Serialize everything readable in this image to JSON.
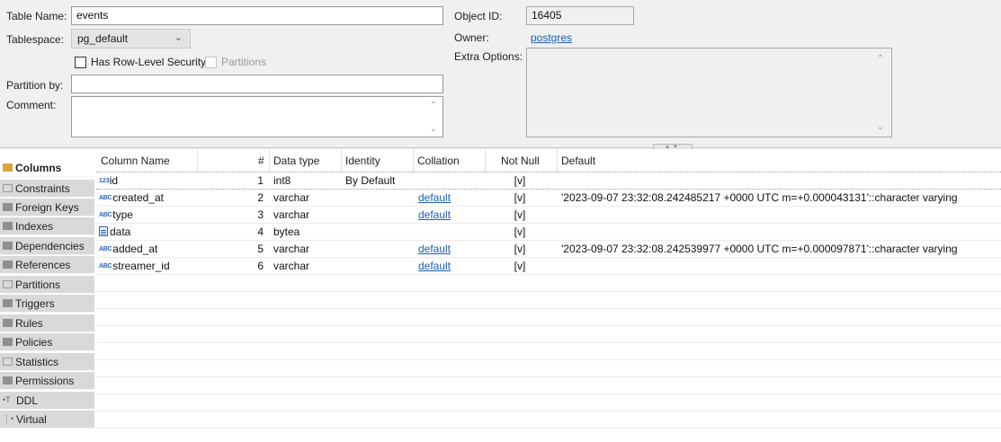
{
  "properties": {
    "table_name_label": "Table Name:",
    "table_name_value": "events",
    "tablespace_label": "Tablespace:",
    "tablespace_value": "pg_default",
    "rls_label": "Has Row-Level Security",
    "partitions_label": "Partitions",
    "partition_by_label": "Partition by:",
    "partition_by_value": "",
    "comment_label": "Comment:",
    "comment_value": "",
    "object_id_label": "Object ID:",
    "object_id_value": "16405",
    "owner_label": "Owner:",
    "owner_value": "postgres",
    "extra_options_label": "Extra Options:",
    "extra_options_value": ""
  },
  "tabs": [
    {
      "label": "Columns",
      "icon": "columns-icon",
      "active": true
    },
    {
      "label": "Constraints",
      "icon": "constraints-icon",
      "active": false
    },
    {
      "label": "Foreign Keys",
      "icon": "foreign-keys-icon",
      "active": false
    },
    {
      "label": "Indexes",
      "icon": "indexes-icon",
      "active": false
    },
    {
      "label": "Dependencies",
      "icon": "dependencies-icon",
      "active": false
    },
    {
      "label": "References",
      "icon": "references-icon",
      "active": false
    },
    {
      "label": "Partitions",
      "icon": "partitions-icon",
      "active": false
    },
    {
      "label": "Triggers",
      "icon": "triggers-icon",
      "active": false
    },
    {
      "label": "Rules",
      "icon": "rules-icon",
      "active": false
    },
    {
      "label": "Policies",
      "icon": "policies-icon",
      "active": false
    },
    {
      "label": "Statistics",
      "icon": "statistics-icon",
      "active": false
    },
    {
      "label": "Permissions",
      "icon": "permissions-icon",
      "active": false
    },
    {
      "label": "DDL",
      "icon": "ddl-icon",
      "active": false
    },
    {
      "label": "Virtual",
      "icon": "virtual-icon",
      "active": false
    }
  ],
  "grid": {
    "headers": [
      "Column Name",
      "#",
      "Data type",
      "Identity",
      "Collation",
      "Not Null",
      "Default"
    ],
    "rows": [
      {
        "name": "id",
        "icon": "123",
        "num": "1",
        "type": "int8",
        "identity": "By Default",
        "collation": "",
        "not_null": "[v]",
        "default": ""
      },
      {
        "name": "created_at",
        "icon": "ABC",
        "num": "2",
        "type": "varchar",
        "identity": "",
        "collation": "default",
        "not_null": "[v]",
        "default": "'2023-09-07 23:32:08.242485217 +0000 UTC m=+0.000043131'::character varying"
      },
      {
        "name": "type",
        "icon": "ABC",
        "num": "3",
        "type": "varchar",
        "identity": "",
        "collation": "default",
        "not_null": "[v]",
        "default": ""
      },
      {
        "name": "data",
        "icon": "binary",
        "num": "4",
        "type": "bytea",
        "identity": "",
        "collation": "",
        "not_null": "[v]",
        "default": ""
      },
      {
        "name": "added_at",
        "icon": "ABC",
        "num": "5",
        "type": "varchar",
        "identity": "",
        "collation": "default",
        "not_null": "[v]",
        "default": "'2023-09-07 23:32:08.242539977 +0000 UTC m=+0.000097871'::character varying"
      },
      {
        "name": "streamer_id",
        "icon": "ABC",
        "num": "6",
        "type": "varchar",
        "identity": "",
        "collation": "default",
        "not_null": "[v]",
        "default": ""
      }
    ]
  },
  "colors": {
    "link": "#1a5fb4",
    "type_icon": "#2a62b8",
    "tab_bg": "#d9d9d9",
    "accent_gold": "#d9a43a"
  }
}
